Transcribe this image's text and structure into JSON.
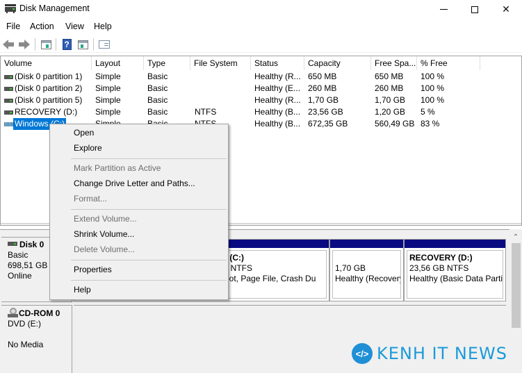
{
  "window": {
    "title": "Disk Management",
    "controls": {
      "minimize": "minimize",
      "maximize": "maximize",
      "close": "✕"
    }
  },
  "menubar": [
    "File",
    "Action",
    "View",
    "Help"
  ],
  "toolbar": {
    "buttons": [
      "back-icon",
      "forward-icon",
      "show-hide-console-tree-icon",
      "help-icon",
      "show-hide-action-pane-icon",
      "properties-icon"
    ],
    "help_glyph": "?"
  },
  "volume_list": {
    "columns": [
      "Volume",
      "Layout",
      "Type",
      "File System",
      "Status",
      "Capacity",
      "Free Spa...",
      "% Free"
    ],
    "rows": [
      {
        "volume": "(Disk 0 partition 1)",
        "layout": "Simple",
        "type": "Basic",
        "fs": "",
        "status": "Healthy (R...",
        "capacity": "650 MB",
        "free": "650 MB",
        "pct": "100 %"
      },
      {
        "volume": "(Disk 0 partition 2)",
        "layout": "Simple",
        "type": "Basic",
        "fs": "",
        "status": "Healthy (E...",
        "capacity": "260 MB",
        "free": "260 MB",
        "pct": "100 %"
      },
      {
        "volume": "(Disk 0 partition 5)",
        "layout": "Simple",
        "type": "Basic",
        "fs": "",
        "status": "Healthy (R...",
        "capacity": "1,70 GB",
        "free": "1,70 GB",
        "pct": "100 %"
      },
      {
        "volume": "RECOVERY (D:)",
        "layout": "Simple",
        "type": "Basic",
        "fs": "NTFS",
        "status": "Healthy (B...",
        "capacity": "23,56 GB",
        "free": "1,20 GB",
        "pct": "5 %"
      },
      {
        "volume": "Windows (C:)",
        "layout": "Simple",
        "type": "Basic",
        "fs": "NTFS",
        "status": "Healthy (B...",
        "capacity": "672,35 GB",
        "free": "560,49 GB",
        "pct": "83 %",
        "selected": true
      }
    ]
  },
  "context_menu": {
    "items": [
      {
        "label": "Open",
        "enabled": true
      },
      {
        "label": "Explore",
        "enabled": true
      },
      {
        "label": "Mark Partition as Active",
        "enabled": false
      },
      {
        "label": "Change Drive Letter and Paths...",
        "enabled": true
      },
      {
        "label": "Format...",
        "enabled": false
      },
      {
        "label": "Extend Volume...",
        "enabled": false
      },
      {
        "label": "Shrink Volume...",
        "enabled": true
      },
      {
        "label": "Delete Volume...",
        "enabled": false
      },
      {
        "label": "Properties",
        "enabled": true
      },
      {
        "label": "Help",
        "enabled": true
      }
    ]
  },
  "disks": [
    {
      "name": "Disk 0",
      "type": "Basic",
      "size": "698,51 GB",
      "state": "Online",
      "partitions": [
        {
          "title": "Windows  (C:)",
          "title_visible": "ws  (C:)",
          "line2": "GB NTFS",
          "line3": "(Boot, Page File, Crash Du"
        },
        {
          "title": "",
          "line2": "1,70 GB",
          "line3": "Healthy (Recovery"
        },
        {
          "title": "RECOVERY  (D:)",
          "line2": "23,56 GB NTFS",
          "line3": "Healthy (Basic Data Partit"
        }
      ]
    },
    {
      "name": "CD-ROM 0",
      "type": "DVD (E:)",
      "state": "No Media"
    }
  ],
  "watermark": {
    "logo": "</>",
    "text": "KENH IT NEWS"
  },
  "colors": {
    "selection": "#0078d7",
    "partition_header": "#0a0a82",
    "watermark": "#1a9ad9"
  }
}
